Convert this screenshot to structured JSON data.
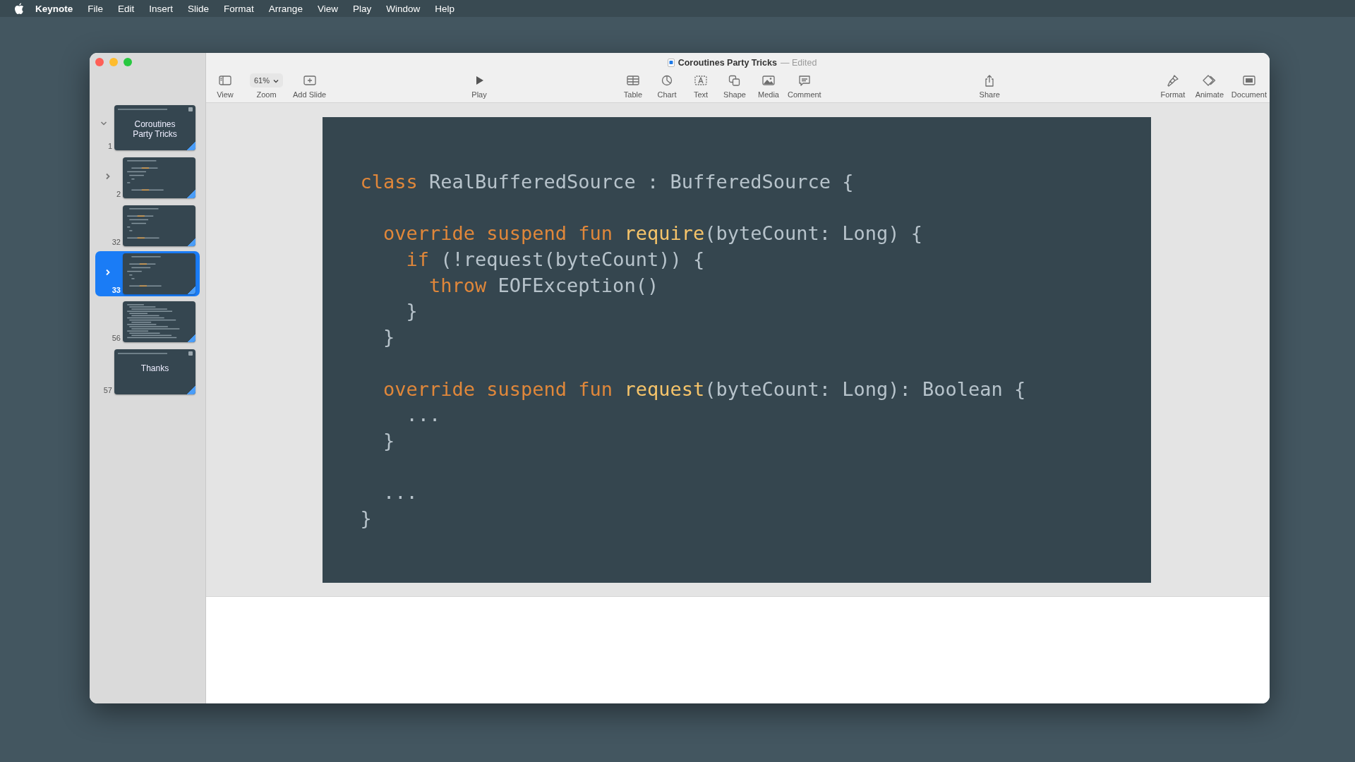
{
  "menu_bar": {
    "app": "Keynote",
    "items": [
      "File",
      "Edit",
      "Insert",
      "Slide",
      "Format",
      "Arrange",
      "View",
      "Play",
      "Window",
      "Help"
    ]
  },
  "window": {
    "title": "Coroutines Party Tricks",
    "status": "— Edited"
  },
  "toolbar": [
    {
      "items": [
        {
          "kind": "view",
          "label": "View"
        },
        {
          "kind": "zoom",
          "label": "Zoom",
          "value": "61%"
        },
        {
          "kind": "add-slide",
          "label": "Add Slide"
        }
      ]
    },
    {
      "items": [
        {
          "kind": "play",
          "label": "Play"
        }
      ]
    },
    {
      "items": [
        {
          "kind": "table",
          "label": "Table"
        },
        {
          "kind": "chart",
          "label": "Chart"
        },
        {
          "kind": "text",
          "label": "Text"
        },
        {
          "kind": "shape",
          "label": "Shape"
        },
        {
          "kind": "media",
          "label": "Media"
        },
        {
          "kind": "comment",
          "label": "Comment"
        }
      ]
    },
    {
      "items": [
        {
          "kind": "share",
          "label": "Share"
        }
      ]
    },
    {
      "items": [
        {
          "kind": "format",
          "label": "Format"
        },
        {
          "kind": "animate",
          "label": "Animate"
        },
        {
          "kind": "document",
          "label": "Document"
        }
      ]
    }
  ],
  "slides": [
    {
      "number": "1",
      "kind": "title",
      "title": "Coroutines Party Tricks",
      "expanded": true,
      "selected": false,
      "children": [
        {
          "number": "2",
          "kind": "code",
          "expanded": false,
          "selected": false
        },
        {
          "number": "32",
          "kind": "code",
          "selected": false
        },
        {
          "number": "33",
          "kind": "code",
          "expanded": false,
          "selected": true
        },
        {
          "number": "56",
          "kind": "dense-code",
          "selected": false
        }
      ]
    },
    {
      "number": "57",
      "kind": "title",
      "title": "Thanks",
      "selected": false
    }
  ],
  "slide": {
    "lines": [
      {
        "tokens": [
          {
            "kind": "keyword",
            "text": "class"
          },
          {
            "kind": "plain",
            "text": " RealBufferedSource : BufferedSource {"
          }
        ]
      },
      {
        "kind": "blank"
      },
      {
        "tokens": [
          {
            "kind": "keyword",
            "text": "  override suspend fun "
          },
          {
            "kind": "function",
            "text": "require"
          },
          {
            "kind": "plain",
            "text": "(byteCount: Long) {"
          }
        ]
      },
      {
        "tokens": [
          {
            "kind": "keyword",
            "text": "    if"
          },
          {
            "kind": "plain",
            "text": " (!request(byteCount)) {"
          }
        ]
      },
      {
        "tokens": [
          {
            "kind": "keyword",
            "text": "      throw"
          },
          {
            "kind": "plain",
            "text": " EOFException()"
          }
        ]
      },
      {
        "tokens": [
          {
            "kind": "plain",
            "text": "    }"
          }
        ]
      },
      {
        "tokens": [
          {
            "kind": "plain",
            "text": "  }"
          }
        ]
      },
      {
        "kind": "blank"
      },
      {
        "tokens": [
          {
            "kind": "keyword",
            "text": "  override suspend fun "
          },
          {
            "kind": "function",
            "text": "request"
          },
          {
            "kind": "plain",
            "text": "(byteCount: Long): Boolean {"
          }
        ]
      },
      {
        "tokens": [
          {
            "kind": "plain",
            "text": "    ..."
          }
        ]
      },
      {
        "tokens": [
          {
            "kind": "plain",
            "text": "  }"
          }
        ]
      },
      {
        "kind": "blank"
      },
      {
        "tokens": [
          {
            "kind": "plain",
            "text": "  ..."
          }
        ]
      },
      {
        "tokens": [
          {
            "kind": "plain",
            "text": "}"
          }
        ]
      }
    ]
  }
}
